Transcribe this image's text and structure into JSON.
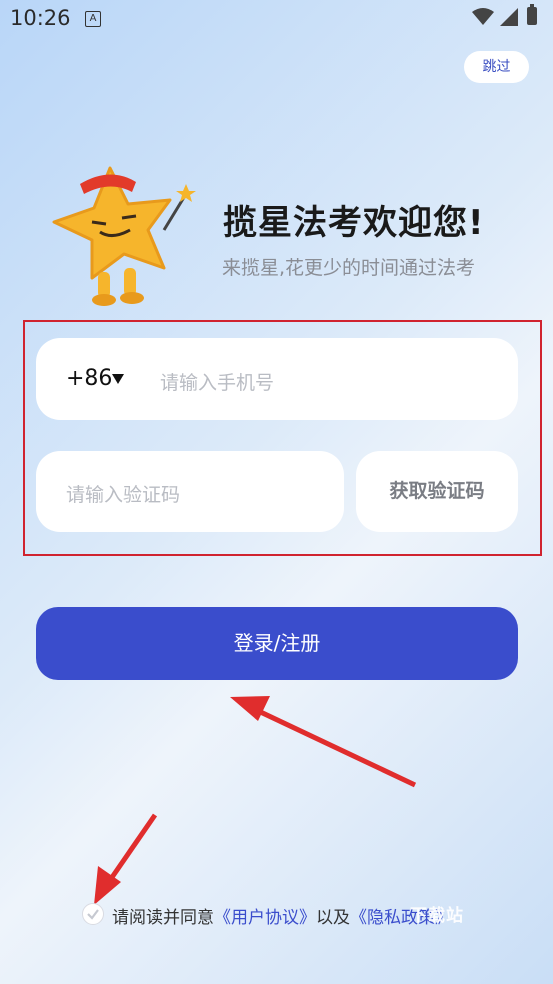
{
  "status_bar": {
    "time": "10:26",
    "notification_icon": "A"
  },
  "header": {
    "skip_label": "跳过"
  },
  "hero": {
    "title": "揽星法考欢迎您!",
    "subtitle": "来揽星,花更少的时间通过法考"
  },
  "form": {
    "country_code": "+86",
    "phone_placeholder": "请输入手机号",
    "code_placeholder": "请输入验证码",
    "get_code_label": "获取验证码"
  },
  "login": {
    "label": "登录/注册"
  },
  "agreement": {
    "prefix": "请阅读并同意",
    "user_agreement": "《用户协议》",
    "connector": "以及",
    "privacy_policy": "《隐私政策》"
  },
  "watermark": "下载站",
  "colors": {
    "primary": "#3a4dcc",
    "annotation": "#d0232f"
  }
}
